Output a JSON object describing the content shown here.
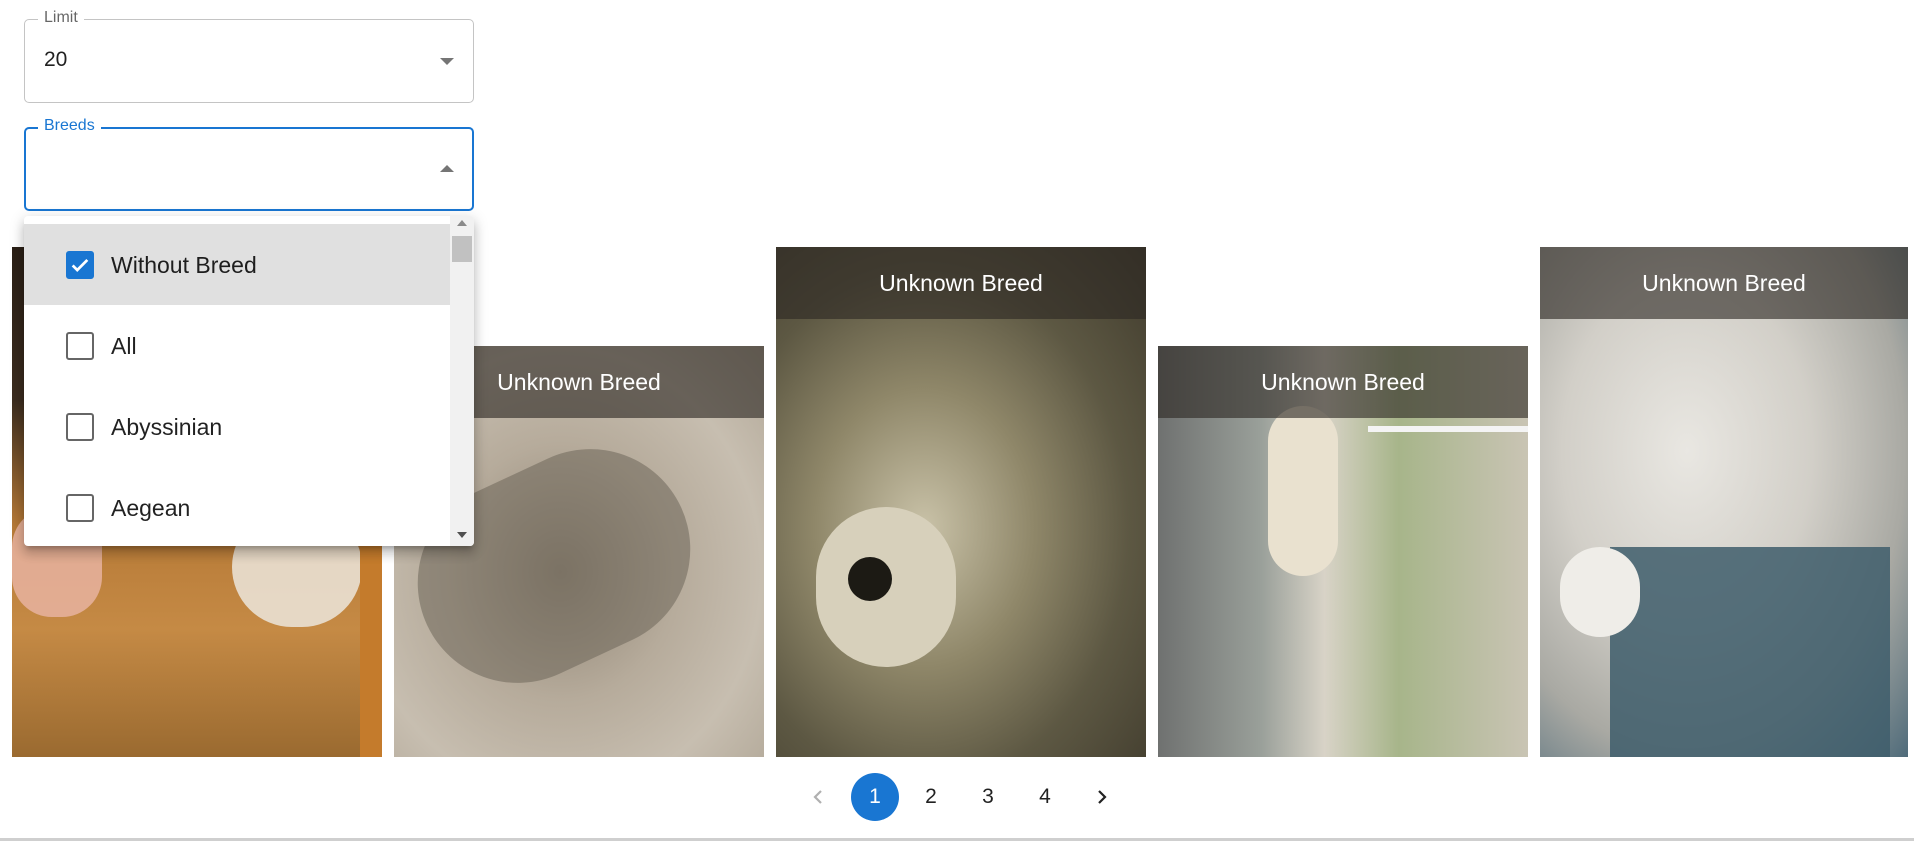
{
  "limit": {
    "label": "Limit",
    "value": "20"
  },
  "breeds": {
    "label": "Breeds",
    "options": [
      {
        "label": "Without Breed",
        "checked": true
      },
      {
        "label": "All",
        "checked": false
      },
      {
        "label": "Abyssinian",
        "checked": false
      },
      {
        "label": "Aegean",
        "checked": false
      }
    ]
  },
  "gallery": {
    "tiles": [
      {
        "caption": ""
      },
      {
        "caption": "Unknown Breed"
      },
      {
        "caption": "Unknown Breed"
      },
      {
        "caption": "Unknown Breed"
      },
      {
        "caption": "Unknown Breed"
      }
    ]
  },
  "pagination": {
    "pages": [
      "1",
      "2",
      "3",
      "4"
    ],
    "current": "1",
    "prev_icon": "chevron-left-icon",
    "next_icon": "chevron-right-icon"
  },
  "colors": {
    "accent": "#1976d2",
    "selected_row": "#e0e0e0",
    "caption_bar": "#2d2823"
  }
}
